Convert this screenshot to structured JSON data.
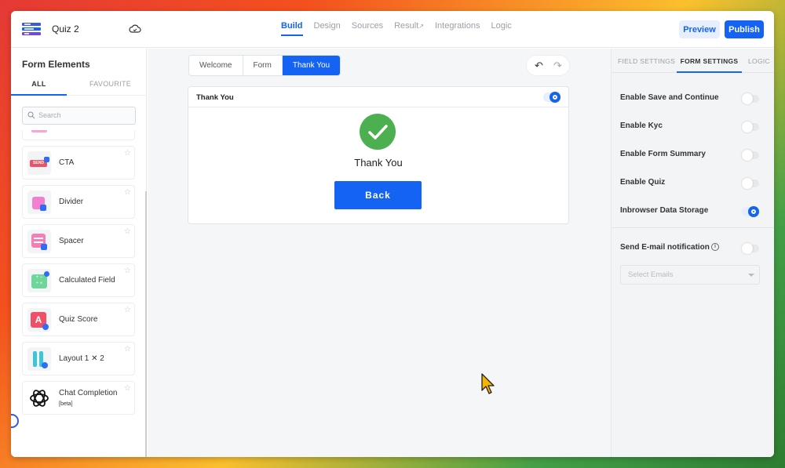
{
  "header": {
    "app_title": "Quiz 2",
    "nav": [
      "Build",
      "Design",
      "Sources",
      "Result",
      "Integrations",
      "Logic"
    ],
    "active_nav": "Build",
    "preview_label": "Preview",
    "publish_label": "Publish"
  },
  "sidebar": {
    "title": "Form Elements",
    "tabs": [
      "ALL",
      "FAVOURITE"
    ],
    "search_placeholder": "Search",
    "items": [
      {
        "label": "CTA",
        "icon": "send-icon"
      },
      {
        "label": "Divider",
        "icon": "divider-icon"
      },
      {
        "label": "Spacer",
        "icon": "spacer-icon"
      },
      {
        "label": "Calculated Field",
        "icon": "calculator-icon"
      },
      {
        "label": "Quiz Score",
        "icon": "quiz-score-icon"
      },
      {
        "label": "Layout 1 ✕ 2",
        "icon": "layout-icon"
      },
      {
        "label": "Chat Completion",
        "badge": "[beta]",
        "icon": "openai-icon"
      }
    ]
  },
  "canvas": {
    "tabs": [
      "Welcome",
      "Form",
      "Thank You"
    ],
    "active_tab": "Thank You",
    "card_title": "Thank You",
    "message": "Thank You",
    "back_label": "Back"
  },
  "right_panel": {
    "tabs": [
      "FIELD SETTINGS",
      "FORM SETTINGS",
      "LOGIC"
    ],
    "active_tab": "FORM SETTINGS",
    "settings": [
      {
        "label": "Enable Save and Continue",
        "on": false
      },
      {
        "label": "Enable Kyc",
        "on": false
      },
      {
        "label": "Enable Form Summary",
        "on": false
      },
      {
        "label": "Enable Quiz",
        "on": false
      },
      {
        "label": "Inbrowser Data Storage",
        "on": true
      }
    ],
    "email_notification_label": "Send E-mail notification",
    "email_notification_on": false,
    "select_emails_placeholder": "Select Emails"
  },
  "colors": {
    "accent": "#1463f3",
    "success": "#4caf50"
  }
}
